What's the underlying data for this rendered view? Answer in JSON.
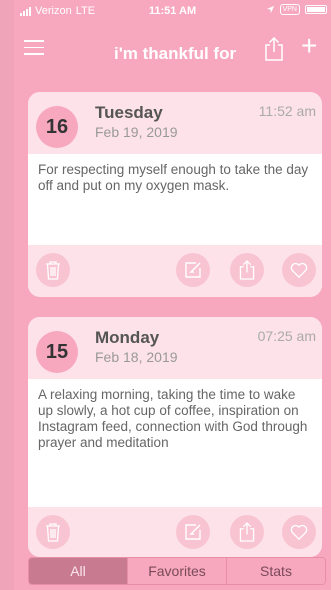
{
  "status_bar": {
    "carrier": "Verizon",
    "network": "LTE",
    "time": "11:51 AM",
    "vpn": "VPN"
  },
  "nav": {
    "title": "i'm thankful for",
    "add_label": "+"
  },
  "entries": [
    {
      "day_number": "16",
      "weekday": "Tuesday",
      "date": "Feb 19, 2019",
      "time": "11:52 am",
      "text": "For respecting myself enough to take the day off and put on my oxygen mask."
    },
    {
      "day_number": "15",
      "weekday": "Monday",
      "date": "Feb 18, 2019",
      "time": "07:25 am",
      "text": "A relaxing morning, taking the time to wake up slowly, a hot cup of coffee, inspiration on Instagram feed, connection with God through prayer and meditation"
    }
  ],
  "tabs": {
    "all": "All",
    "favorites": "Favorites",
    "stats": "Stats",
    "active": "All"
  },
  "colors": {
    "background": "#f7a8bf",
    "card": "#fde2ea",
    "active_tab": "#c77a90"
  }
}
